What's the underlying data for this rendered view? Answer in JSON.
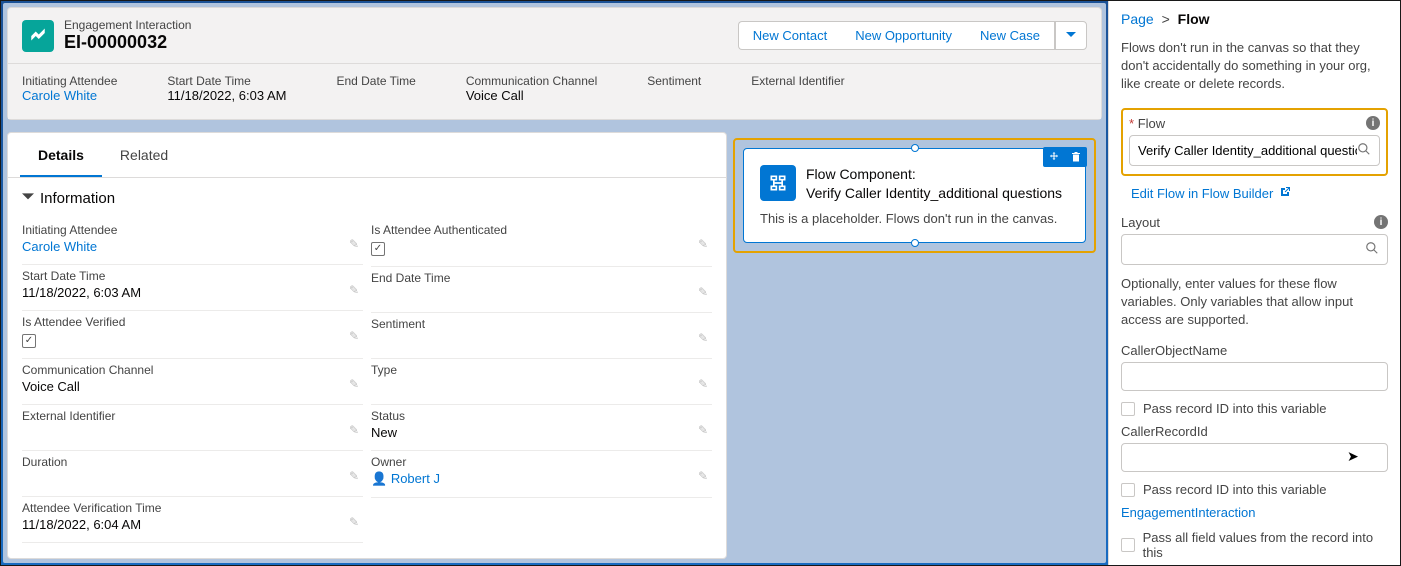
{
  "record": {
    "subtitle": "Engagement Interaction",
    "title": "EI-00000032",
    "actions": {
      "new_contact": "New Contact",
      "new_opportunity": "New Opportunity",
      "new_case": "New Case"
    },
    "highlights": {
      "initiating_attendee_label": "Initiating Attendee",
      "initiating_attendee_value": "Carole White",
      "start_label": "Start Date Time",
      "start_value": "11/18/2022, 6:03 AM",
      "end_label": "End Date Time",
      "channel_label": "Communication Channel",
      "channel_value": "Voice Call",
      "sentiment_label": "Sentiment",
      "ext_label": "External Identifier"
    }
  },
  "tabs": {
    "details": "Details",
    "related": "Related"
  },
  "section": {
    "information": "Information"
  },
  "details": {
    "init_attendee_label": "Initiating Attendee",
    "init_attendee_value": "Carole White",
    "start_label": "Start Date Time",
    "start_value": "11/18/2022, 6:03 AM",
    "is_verified_label": "Is Attendee Verified",
    "channel_label": "Communication Channel",
    "channel_value": "Voice Call",
    "ext_label": "External Identifier",
    "duration_label": "Duration",
    "verif_time_label": "Attendee Verification Time",
    "verif_time_value": "11/18/2022, 6:04 AM",
    "is_auth_label": "Is Attendee Authenticated",
    "end_label": "End Date Time",
    "sentiment_label": "Sentiment",
    "type_label": "Type",
    "status_label": "Status",
    "status_value": "New",
    "owner_label": "Owner",
    "owner_value": "Robert J"
  },
  "flow_component": {
    "line1": "Flow Component:",
    "line2": "Verify Caller Identity_additional questions",
    "placeholder": "This is a placeholder. Flows don't run in the canvas."
  },
  "right": {
    "breadcrumb_page": "Page",
    "breadcrumb_current": "Flow",
    "help": "Flows don't run in the canvas so that they don't accidentally do something in your org, like create or delete records.",
    "flow_label": "Flow",
    "flow_value": "Verify Caller Identity_additional questions",
    "edit_flow": "Edit Flow in Flow Builder",
    "layout_label": "Layout",
    "vars_help": "Optionally, enter values for these flow variables. Only variables that allow input access are supported.",
    "var1_label": "CallerObjectName",
    "pass_record": "Pass record ID into this variable",
    "var2_label": "CallerRecordId",
    "engagement_link": "EngagementInteraction",
    "pass_all": "Pass all field values from the record into this"
  }
}
